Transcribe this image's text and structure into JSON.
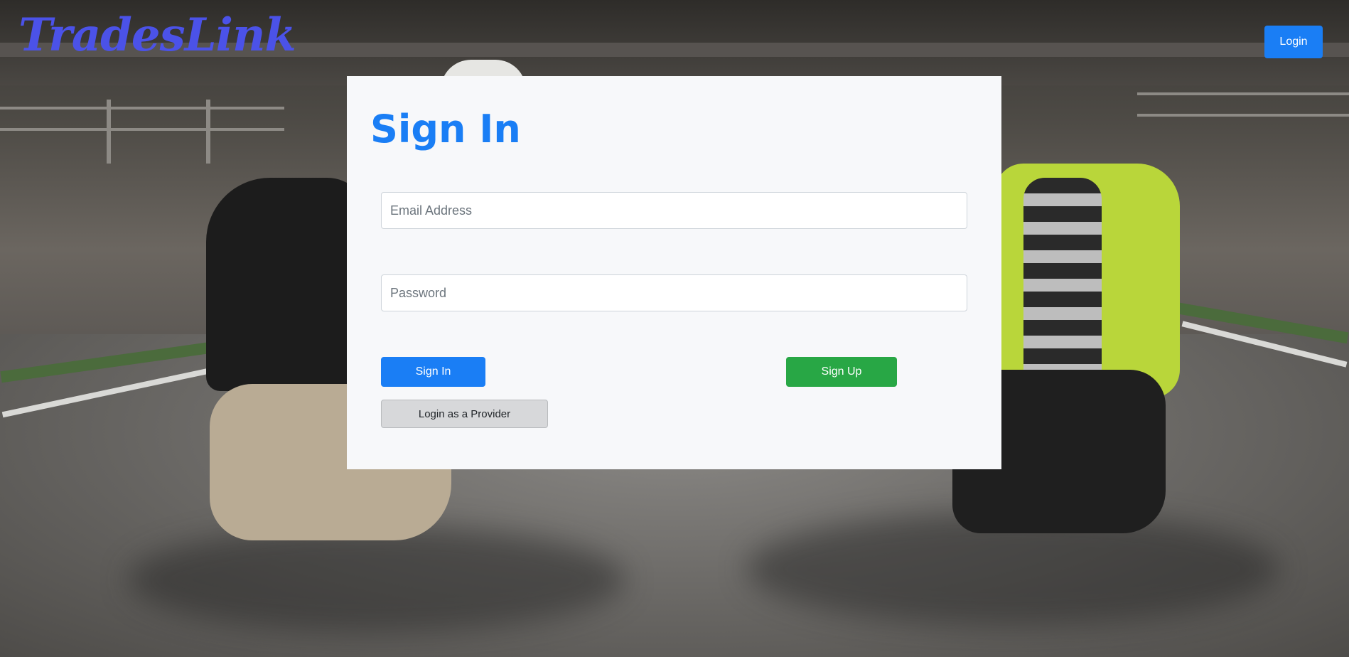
{
  "navbar": {
    "brand": "TradesLink",
    "login_label": "Login"
  },
  "signin_card": {
    "title": "Sign In",
    "email_placeholder": "Email Address",
    "password_placeholder": "Password",
    "signin_label": "Sign In",
    "signup_label": "Sign Up",
    "provider_label": "Login as a Provider"
  },
  "colors": {
    "primary": "#1a7ef5",
    "success": "#28a745",
    "brand": "#4b52e8",
    "card_bg": "#f7f8fa"
  }
}
